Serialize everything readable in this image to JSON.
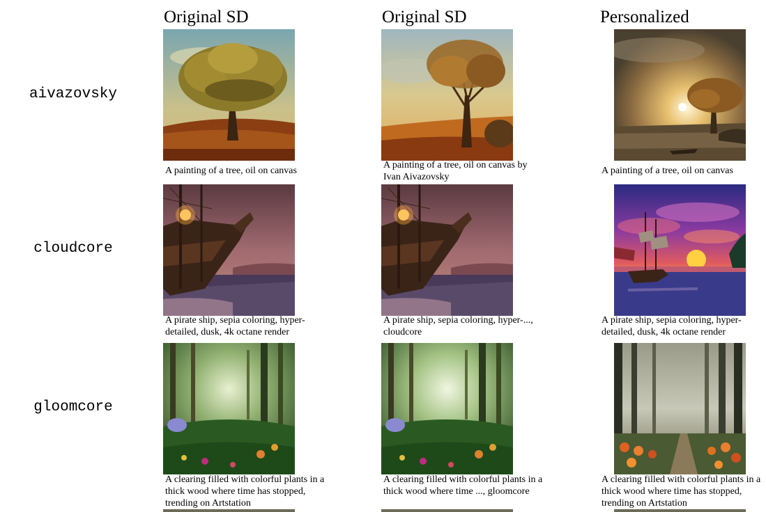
{
  "figure": {
    "column_headers": [
      "Original SD",
      "Original SD",
      "Personalized"
    ],
    "rows": [
      {
        "label": "aivazovsky",
        "captions": [
          "A painting of a tree, oil on canvas",
          "A painting of a tree, oil on canvas by Ivan Aivazovsky",
          "A painting of a tree, oil on canvas"
        ]
      },
      {
        "label": "cloudcore",
        "captions": [
          "A pirate ship, sepia coloring, hyper-detailed, dusk, 4k octane render",
          "A pirate ship, sepia coloring, hyper-..., cloudcore",
          "A pirate ship, sepia coloring, hyper-detailed, dusk, 4k octane render"
        ]
      },
      {
        "label": "gloomcore",
        "captions": [
          "A clearing filled with colorful plants in a thick wood where time has stopped, trending on Artstation",
          "A clearing filled with colorful plants in a thick wood where time ..., gloomcore",
          "A clearing filled with colorful plants in a thick wood where time has stopped, trending on Artstation"
        ]
      }
    ]
  }
}
